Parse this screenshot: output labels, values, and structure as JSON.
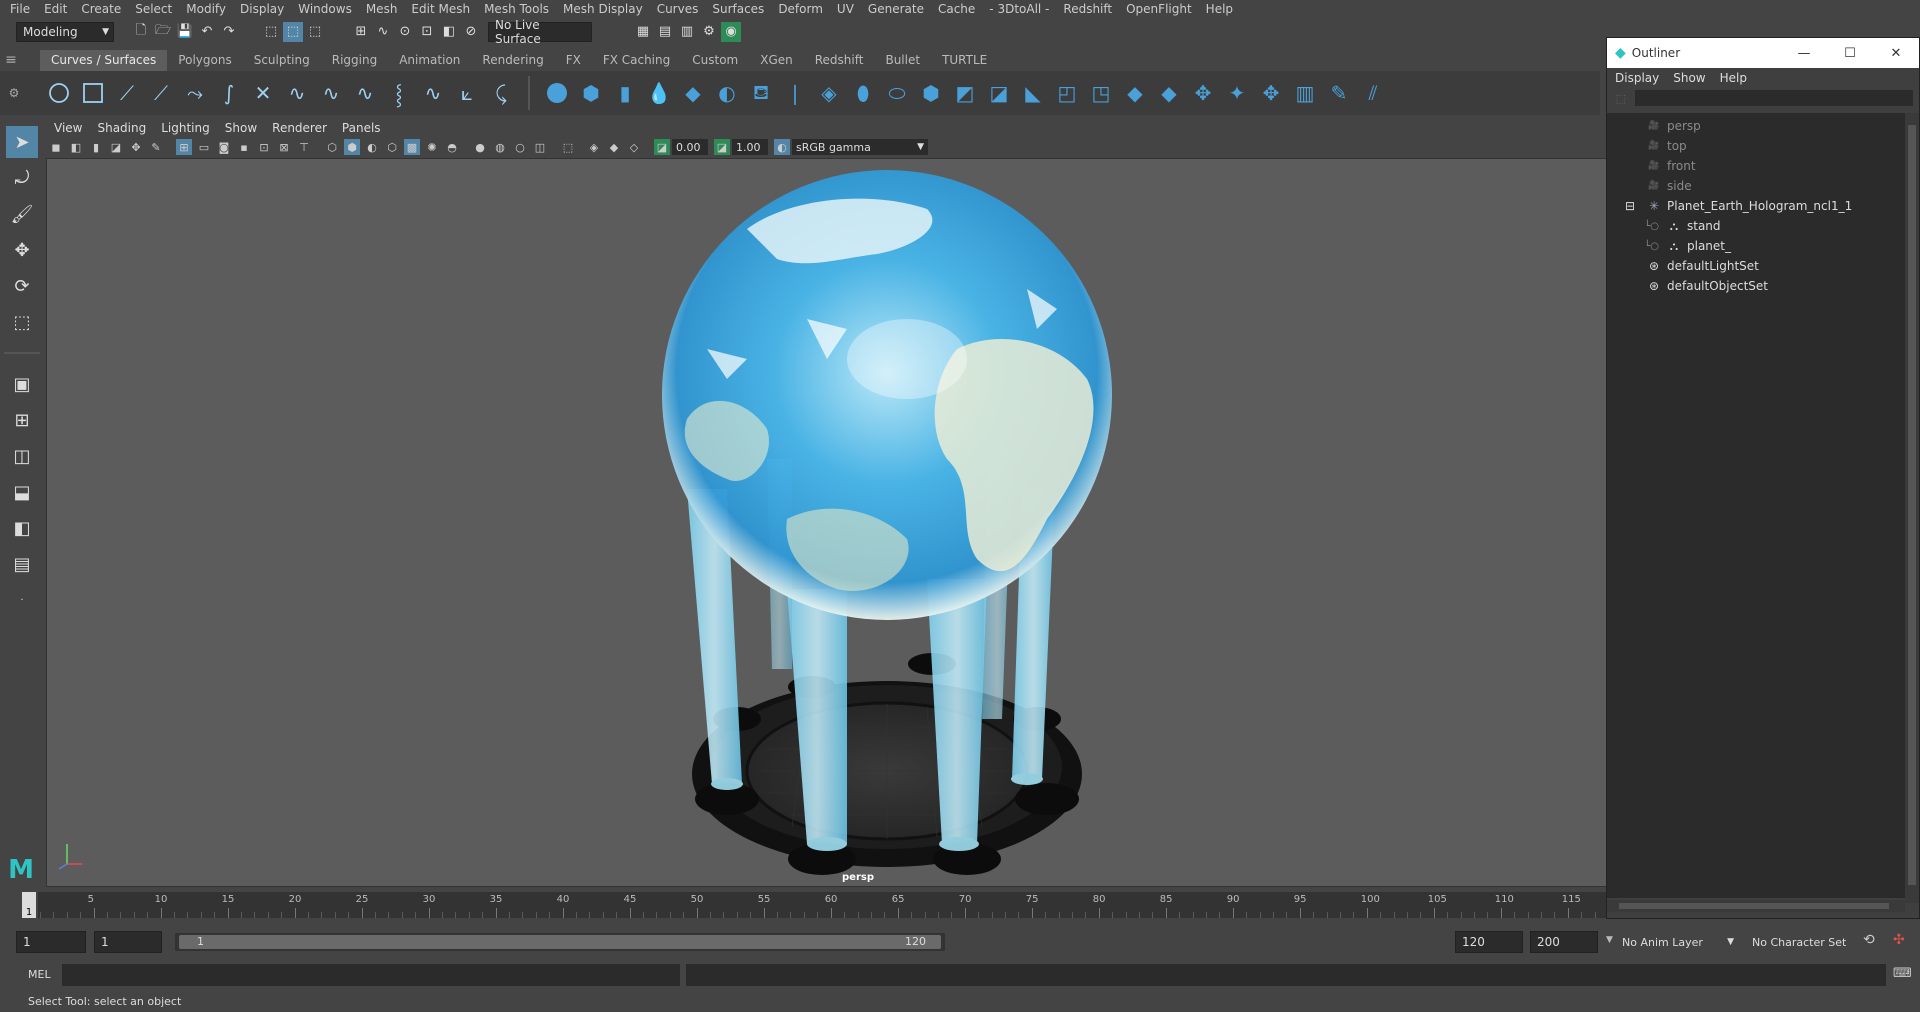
{
  "menubar": [
    "File",
    "Edit",
    "Create",
    "Select",
    "Modify",
    "Display",
    "Windows",
    "Mesh",
    "Edit Mesh",
    "Mesh Tools",
    "Mesh Display",
    "Curves",
    "Surfaces",
    "Deform",
    "UV",
    "Generate",
    "Cache",
    "- 3DtoAll -",
    "Redshift",
    "OpenFlight",
    "Help"
  ],
  "statusline": {
    "mode": "Modeling",
    "live_surface": "No Live Surface"
  },
  "shelf_tabs": [
    "Curves / Surfaces",
    "Polygons",
    "Sculpting",
    "Rigging",
    "Animation",
    "Rendering",
    "FX",
    "FX Caching",
    "Custom",
    "XGen",
    "Redshift",
    "Bullet",
    "TURTLE"
  ],
  "shelf_active": "Curves / Surfaces",
  "viewport": {
    "menu": [
      "View",
      "Shading",
      "Lighting",
      "Show",
      "Renderer",
      "Panels"
    ],
    "exposure": "0.00",
    "gamma": "1.00",
    "color_space": "sRGB gamma",
    "camera_label": "persp"
  },
  "outliner": {
    "title": "Outliner",
    "menu": [
      "Display",
      "Show",
      "Help"
    ],
    "items": [
      {
        "label": "persp",
        "type": "camera"
      },
      {
        "label": "top",
        "type": "camera"
      },
      {
        "label": "front",
        "type": "camera"
      },
      {
        "label": "side",
        "type": "camera"
      },
      {
        "label": "Planet_Earth_Hologram_ncl1_1",
        "type": "group"
      },
      {
        "label": "stand",
        "type": "mesh"
      },
      {
        "label": "planet_",
        "type": "mesh"
      },
      {
        "label": "defaultLightSet",
        "type": "set"
      },
      {
        "label": "defaultObjectSet",
        "type": "set"
      }
    ]
  },
  "timeline": {
    "ticks": [
      "5",
      "10",
      "15",
      "20",
      "25",
      "30",
      "35",
      "40",
      "45",
      "50",
      "55",
      "60",
      "65",
      "70",
      "75",
      "80",
      "85",
      "90",
      "95",
      "100",
      "105",
      "110",
      "115"
    ],
    "current_frame": "1"
  },
  "range": {
    "start": "1",
    "start_inner": "1",
    "slider_start": "1",
    "slider_end": "120",
    "end_inner": "120",
    "end": "200",
    "anim_layer": "No Anim Layer",
    "character_set": "No Character Set"
  },
  "cmdline": {
    "lang": "MEL"
  },
  "helpline": "Select Tool: select an object",
  "colors": {
    "accent": "#5285a6",
    "viewport_bg": "#5c5c5c",
    "hologram": "#8fe0ff"
  }
}
